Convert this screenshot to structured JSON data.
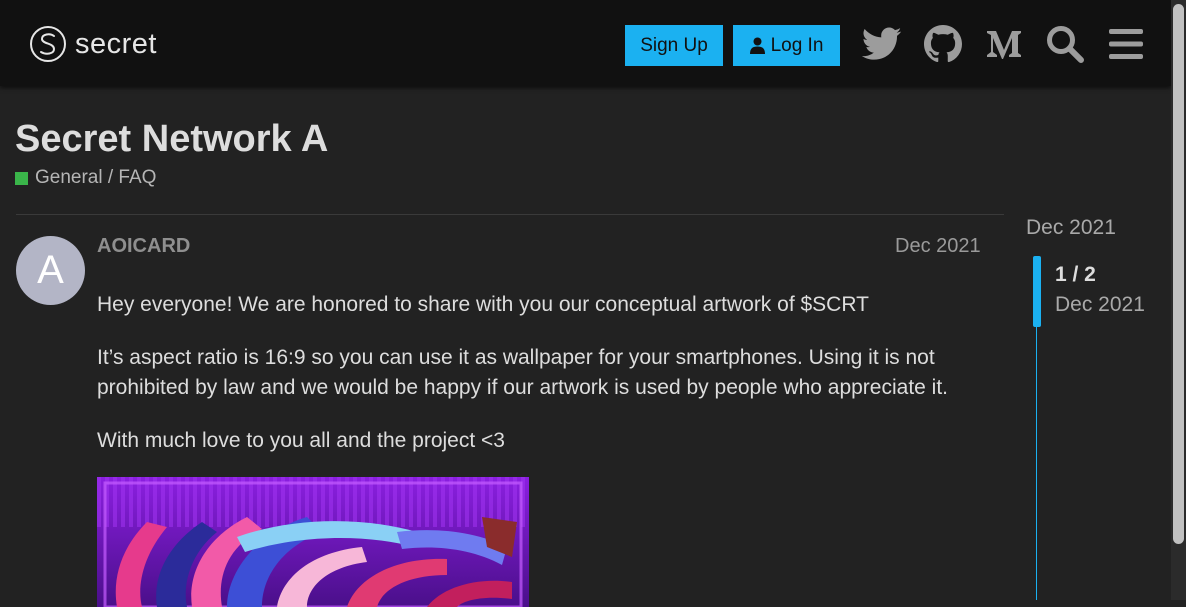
{
  "header": {
    "logo_text": "secret",
    "signup_label": "Sign Up",
    "login_label": "Log In",
    "accent_color": "#1bb1f1",
    "icons": [
      "twitter-icon",
      "github-icon",
      "medium-icon",
      "search-icon",
      "menu-icon"
    ]
  },
  "topic": {
    "title": "Secret Network A",
    "category": "General / FAQ",
    "category_color": "#3ab54a"
  },
  "post": {
    "avatar_letter": "A",
    "username": "AOICARD",
    "date": "Dec 2021",
    "paragraphs": [
      "Hey everyone! We are honored to share with you our conceptual artwork of $SCRT",
      "It’s aspect ratio is 16:9 so you can use it as wallpaper for your smartphones. Using it is not prohibited by law and we would be happy if our artwork is used by people who appreciate it.",
      "With much love to you all and the project <3"
    ]
  },
  "timeline": {
    "top_date": "Dec 2021",
    "position": "1 / 2",
    "current_date": "Dec 2021"
  }
}
